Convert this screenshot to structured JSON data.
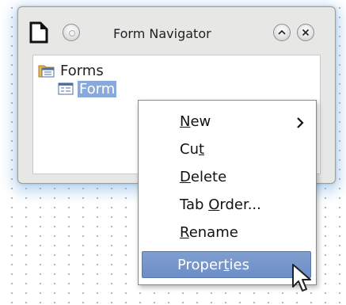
{
  "window": {
    "title": "Form Navigator"
  },
  "tree": {
    "root_label": "Forms",
    "child_label": "Form"
  },
  "context_menu": {
    "items": [
      {
        "before": "",
        "mnemonic": "N",
        "after": "ew",
        "has_submenu": true
      },
      {
        "before": "Cu",
        "mnemonic": "t",
        "after": "",
        "has_submenu": false
      },
      {
        "before": "",
        "mnemonic": "D",
        "after": "elete",
        "has_submenu": false
      },
      {
        "before": "Tab ",
        "mnemonic": "O",
        "after": "rder...",
        "has_submenu": false
      },
      {
        "before": "",
        "mnemonic": "R",
        "after": "ename",
        "has_submenu": false
      },
      {
        "before": "Proper",
        "mnemonic": "t",
        "after": "ies",
        "has_submenu": false
      }
    ],
    "highlighted_index": 5
  },
  "icons": {
    "app": "document-icon",
    "menu": "window-menu-icon",
    "shade": "chevron-up-icon",
    "close": "close-icon",
    "forms": "folder-form-icon",
    "form": "form-icon",
    "submenu": "chevron-right-icon",
    "cursor": "mouse-pointer-icon"
  },
  "colors": {
    "selection": "#89a9da",
    "menu_highlight": "#7396cc",
    "glow": "#78afe1"
  }
}
